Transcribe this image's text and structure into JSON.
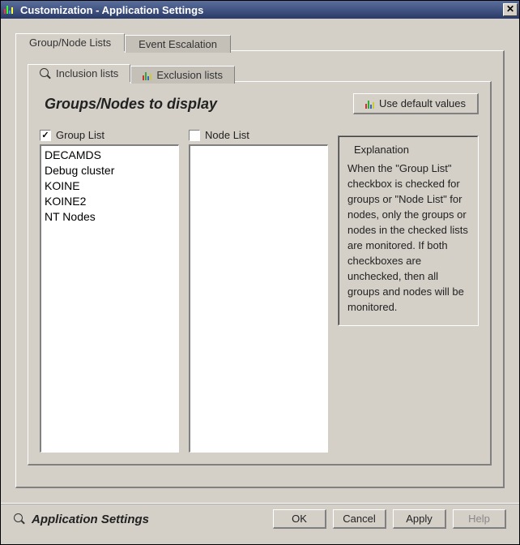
{
  "window": {
    "title": "Customization - Application Settings"
  },
  "outerTabs": {
    "active": "Group/Node Lists",
    "inactive": "Event Escalation"
  },
  "innerTabs": {
    "active": "Inclusion lists",
    "inactive": "Exclusion lists"
  },
  "section": {
    "title": "Groups/Nodes to display",
    "defaultBtn": "Use default values"
  },
  "groupList": {
    "label": "Group List",
    "checked": true,
    "items": [
      "DECAMDS",
      "Debug cluster",
      "KOINE",
      "KOINE2",
      "NT Nodes"
    ]
  },
  "nodeList": {
    "label": "Node List",
    "checked": false,
    "items": []
  },
  "explanation": {
    "title": "Explanation",
    "text": "When the \"Group List\" checkbox is checked for groups or \"Node List\" for nodes, only the groups or nodes in the checked lists are monitored.  If both checkboxes are unchecked, then all groups and nodes will be monitored."
  },
  "footer": {
    "title": "Application Settings",
    "ok": "OK",
    "cancel": "Cancel",
    "apply": "Apply",
    "help": "Help"
  }
}
